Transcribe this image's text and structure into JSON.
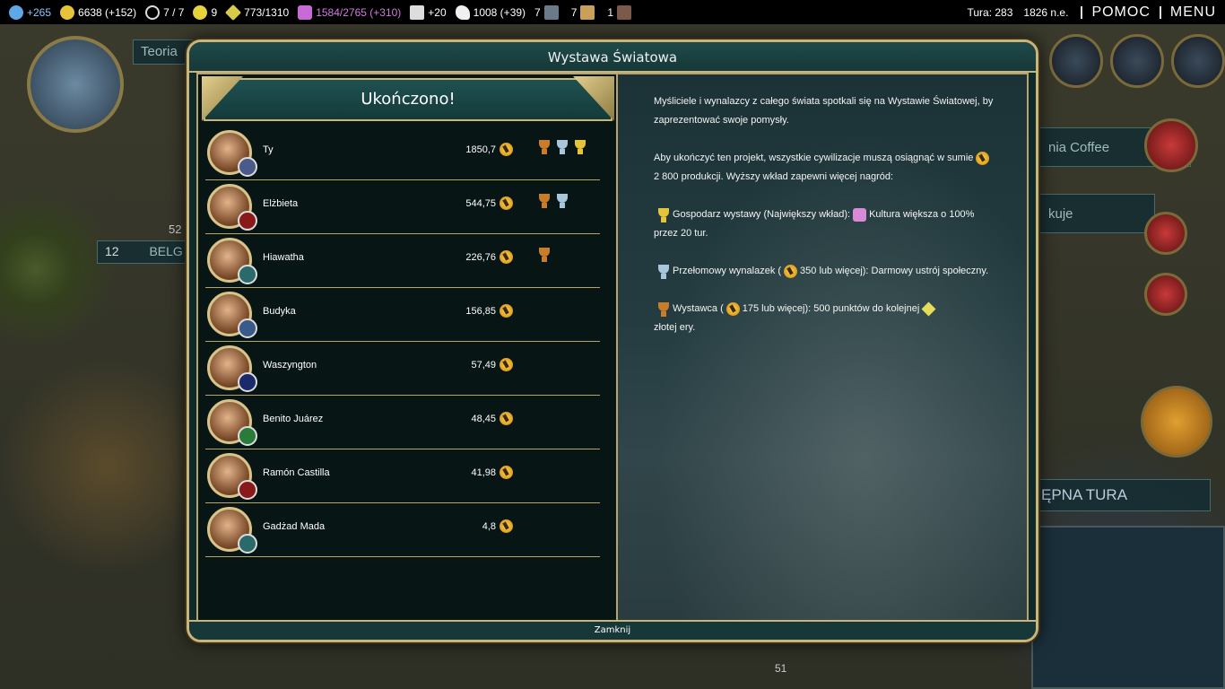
{
  "topbar": {
    "science": "+265",
    "gold": "6638 (+152)",
    "trade": "7 / 7",
    "happiness": "9",
    "golden_age": "773/1310",
    "culture": "1584/2765 (+310)",
    "tourism": "+20",
    "faith": "1008 (+39)",
    "spy_count": "7",
    "great_works": "7",
    "archaeology": "1",
    "turn": "Tura: 283",
    "year": "1826 n.e.",
    "help": "POMOC",
    "menu": "MENU"
  },
  "side": {
    "left_label": "Teoria",
    "city_strength": "52",
    "city_pop": "12",
    "city_name": "BELG",
    "right_label1": "nia Coffee",
    "right_label2": "kuje",
    "next_turn": "ĘPNA TURA",
    "unit_count": "51"
  },
  "dialog": {
    "title": "Wystawa Światowa",
    "status": "Ukończono!",
    "close": "Zamknij",
    "rows": [
      {
        "name": "Ty",
        "value": "1850,7",
        "trophies": [
          "b",
          "s",
          "g"
        ],
        "civ_color": "#4a5a8a"
      },
      {
        "name": "Elżbieta",
        "value": "544,75",
        "trophies": [
          "b",
          "s"
        ],
        "civ_color": "#8a1a1a"
      },
      {
        "name": "Hiawatha",
        "value": "226,76",
        "trophies": [
          "b"
        ],
        "civ_color": "#2a6a6a"
      },
      {
        "name": "Budyka",
        "value": "156,85",
        "trophies": [],
        "civ_color": "#3a5a8a"
      },
      {
        "name": "Waszyngton",
        "value": "57,49",
        "trophies": [],
        "civ_color": "#1a2a6a"
      },
      {
        "name": "Benito Juárez",
        "value": "48,45",
        "trophies": [],
        "civ_color": "#2a7a3a"
      },
      {
        "name": "Ramón Castilla",
        "value": "41,98",
        "trophies": [],
        "civ_color": "#8a1a1a"
      },
      {
        "name": "Gadżad Mada",
        "value": "4,8",
        "trophies": [],
        "civ_color": "#2a6a6a"
      }
    ],
    "desc": {
      "intro": "Myśliciele i wynalazcy z całego świata spotkali się na Wystawie Światowej, by zaprezentować swoje pomysły.",
      "req_a": "Aby ukończyć ten projekt, wszystkie cywilizacje muszą osiągnąć w sumie",
      "req_b": "2 800 produkcji. Wyższy wkład zapewni więcej nagród:",
      "gold_a": "Gospodarz wystawy (Największy wkład):",
      "gold_b": "Kultura większa o 100% przez 20 tur.",
      "silver_a": "Przełomowy wynalazek (",
      "silver_b": "350 lub więcej): Darmowy ustrój społeczny.",
      "bronze_a": "Wystawca (",
      "bronze_b": "175 lub więcej): 500 punktów do kolejnej",
      "bronze_c": "złotej ery."
    }
  }
}
